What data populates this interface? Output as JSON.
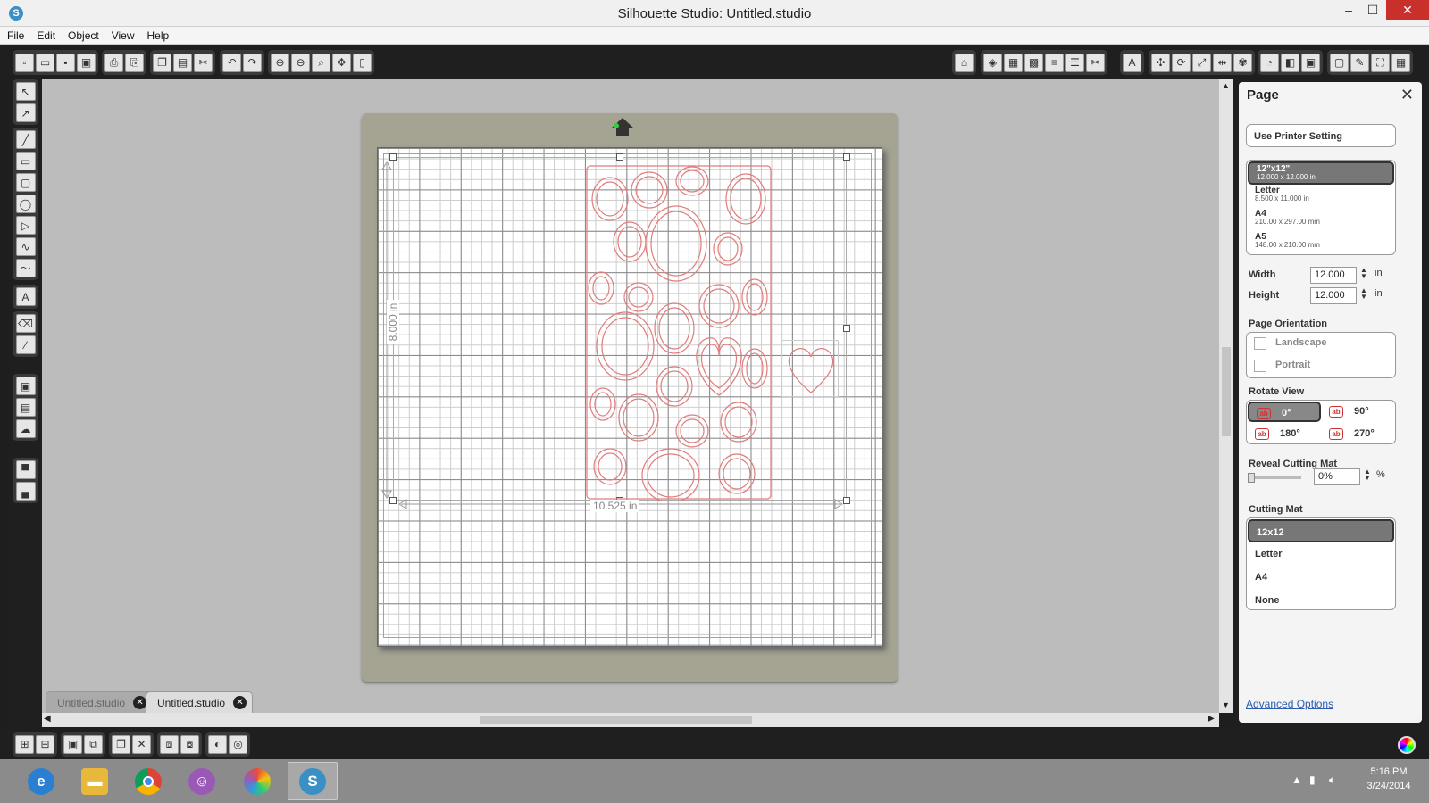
{
  "window": {
    "title": "Silhouette Studio: Untitled.studio",
    "app_icon": "silhouette-logo",
    "controls": {
      "minimize": "–",
      "maximize": "☐",
      "close": "✕"
    }
  },
  "menu": [
    "File",
    "Edit",
    "Object",
    "View",
    "Help"
  ],
  "tabs": [
    {
      "label": "Untitled.studio",
      "active": false
    },
    {
      "label": "Untitled.studio",
      "active": true
    }
  ],
  "canvas": {
    "height_label": "8.000 in",
    "width_label": "10.525 in"
  },
  "panel": {
    "title": "Page",
    "use_printer": "Use Printer Setting",
    "sizes": [
      {
        "name": "12\"x12\"",
        "dims": "12.000 x 12.000 in",
        "selected": true
      },
      {
        "name": "Letter",
        "dims": "8.500 x 11.000 in",
        "selected": false
      },
      {
        "name": "A4",
        "dims": "210.00 x 297.00 mm",
        "selected": false
      },
      {
        "name": "A5",
        "dims": "148.00 x 210.00 mm",
        "selected": false
      }
    ],
    "width_label": "Width",
    "width_value": "12.000",
    "height_label": "Height",
    "height_value": "12.000",
    "unit": "in",
    "orientation_label": "Page Orientation",
    "orientations": [
      "Landscape",
      "Portrait"
    ],
    "rotate_label": "Rotate View",
    "rotations": [
      "0°",
      "90°",
      "180°",
      "270°"
    ],
    "reveal_label": "Reveal Cutting Mat",
    "reveal_value": "0%",
    "reveal_unit": "%",
    "reveal_fraction": 0,
    "mat_label": "Cutting Mat",
    "mats": [
      {
        "name": "12x12",
        "selected": true
      },
      {
        "name": "Letter",
        "selected": false
      },
      {
        "name": "A4",
        "selected": false
      },
      {
        "name": "None",
        "selected": false
      }
    ],
    "advanced": "Advanced Options"
  },
  "taskbar": {
    "apps": [
      "internet-explorer",
      "file-explorer",
      "chrome",
      "messenger",
      "picasa",
      "silhouette-studio"
    ],
    "time": "5:16 PM",
    "date": "3/24/2014"
  }
}
